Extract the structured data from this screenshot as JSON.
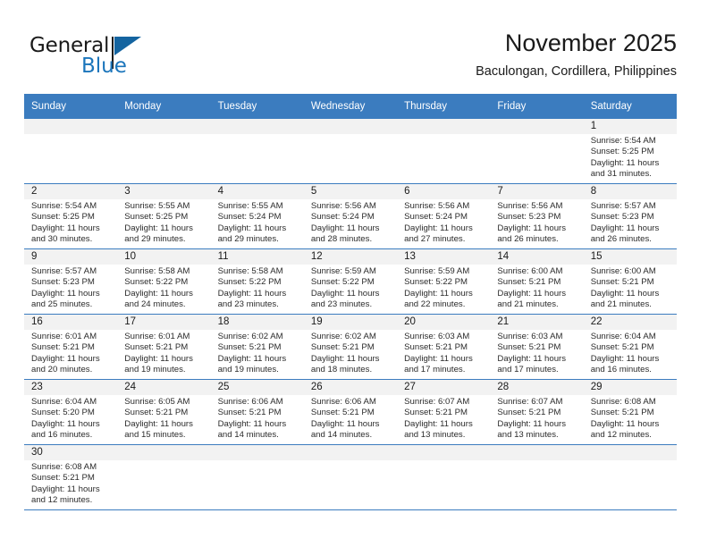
{
  "brand": {
    "word1": "General",
    "word2": "Blue",
    "flag_icon": "blue-triangle-flag-icon",
    "accent_color": "#1b75bb"
  },
  "header": {
    "title": "November 2025",
    "subtitle": "Baculongan, Cordillera, Philippines"
  },
  "theme": {
    "header_row_bg": "#3b7cbf",
    "daynum_band_bg": "#f2f2f2",
    "grid_line": "#3b7cbf"
  },
  "weekdays": [
    "Sunday",
    "Monday",
    "Tuesday",
    "Wednesday",
    "Thursday",
    "Friday",
    "Saturday"
  ],
  "weeks": [
    [
      {
        "day": "",
        "blank": true
      },
      {
        "day": "",
        "blank": true
      },
      {
        "day": "",
        "blank": true
      },
      {
        "day": "",
        "blank": true
      },
      {
        "day": "",
        "blank": true
      },
      {
        "day": "",
        "blank": true
      },
      {
        "day": "1",
        "sunrise": "Sunrise: 5:54 AM",
        "sunset": "Sunset: 5:25 PM",
        "daylight1": "Daylight: 11 hours",
        "daylight2": "and 31 minutes."
      }
    ],
    [
      {
        "day": "2",
        "sunrise": "Sunrise: 5:54 AM",
        "sunset": "Sunset: 5:25 PM",
        "daylight1": "Daylight: 11 hours",
        "daylight2": "and 30 minutes."
      },
      {
        "day": "3",
        "sunrise": "Sunrise: 5:55 AM",
        "sunset": "Sunset: 5:25 PM",
        "daylight1": "Daylight: 11 hours",
        "daylight2": "and 29 minutes."
      },
      {
        "day": "4",
        "sunrise": "Sunrise: 5:55 AM",
        "sunset": "Sunset: 5:24 PM",
        "daylight1": "Daylight: 11 hours",
        "daylight2": "and 29 minutes."
      },
      {
        "day": "5",
        "sunrise": "Sunrise: 5:56 AM",
        "sunset": "Sunset: 5:24 PM",
        "daylight1": "Daylight: 11 hours",
        "daylight2": "and 28 minutes."
      },
      {
        "day": "6",
        "sunrise": "Sunrise: 5:56 AM",
        "sunset": "Sunset: 5:24 PM",
        "daylight1": "Daylight: 11 hours",
        "daylight2": "and 27 minutes."
      },
      {
        "day": "7",
        "sunrise": "Sunrise: 5:56 AM",
        "sunset": "Sunset: 5:23 PM",
        "daylight1": "Daylight: 11 hours",
        "daylight2": "and 26 minutes."
      },
      {
        "day": "8",
        "sunrise": "Sunrise: 5:57 AM",
        "sunset": "Sunset: 5:23 PM",
        "daylight1": "Daylight: 11 hours",
        "daylight2": "and 26 minutes."
      }
    ],
    [
      {
        "day": "9",
        "sunrise": "Sunrise: 5:57 AM",
        "sunset": "Sunset: 5:23 PM",
        "daylight1": "Daylight: 11 hours",
        "daylight2": "and 25 minutes."
      },
      {
        "day": "10",
        "sunrise": "Sunrise: 5:58 AM",
        "sunset": "Sunset: 5:22 PM",
        "daylight1": "Daylight: 11 hours",
        "daylight2": "and 24 minutes."
      },
      {
        "day": "11",
        "sunrise": "Sunrise: 5:58 AM",
        "sunset": "Sunset: 5:22 PM",
        "daylight1": "Daylight: 11 hours",
        "daylight2": "and 23 minutes."
      },
      {
        "day": "12",
        "sunrise": "Sunrise: 5:59 AM",
        "sunset": "Sunset: 5:22 PM",
        "daylight1": "Daylight: 11 hours",
        "daylight2": "and 23 minutes."
      },
      {
        "day": "13",
        "sunrise": "Sunrise: 5:59 AM",
        "sunset": "Sunset: 5:22 PM",
        "daylight1": "Daylight: 11 hours",
        "daylight2": "and 22 minutes."
      },
      {
        "day": "14",
        "sunrise": "Sunrise: 6:00 AM",
        "sunset": "Sunset: 5:21 PM",
        "daylight1": "Daylight: 11 hours",
        "daylight2": "and 21 minutes."
      },
      {
        "day": "15",
        "sunrise": "Sunrise: 6:00 AM",
        "sunset": "Sunset: 5:21 PM",
        "daylight1": "Daylight: 11 hours",
        "daylight2": "and 21 minutes."
      }
    ],
    [
      {
        "day": "16",
        "sunrise": "Sunrise: 6:01 AM",
        "sunset": "Sunset: 5:21 PM",
        "daylight1": "Daylight: 11 hours",
        "daylight2": "and 20 minutes."
      },
      {
        "day": "17",
        "sunrise": "Sunrise: 6:01 AM",
        "sunset": "Sunset: 5:21 PM",
        "daylight1": "Daylight: 11 hours",
        "daylight2": "and 19 minutes."
      },
      {
        "day": "18",
        "sunrise": "Sunrise: 6:02 AM",
        "sunset": "Sunset: 5:21 PM",
        "daylight1": "Daylight: 11 hours",
        "daylight2": "and 19 minutes."
      },
      {
        "day": "19",
        "sunrise": "Sunrise: 6:02 AM",
        "sunset": "Sunset: 5:21 PM",
        "daylight1": "Daylight: 11 hours",
        "daylight2": "and 18 minutes."
      },
      {
        "day": "20",
        "sunrise": "Sunrise: 6:03 AM",
        "sunset": "Sunset: 5:21 PM",
        "daylight1": "Daylight: 11 hours",
        "daylight2": "and 17 minutes."
      },
      {
        "day": "21",
        "sunrise": "Sunrise: 6:03 AM",
        "sunset": "Sunset: 5:21 PM",
        "daylight1": "Daylight: 11 hours",
        "daylight2": "and 17 minutes."
      },
      {
        "day": "22",
        "sunrise": "Sunrise: 6:04 AM",
        "sunset": "Sunset: 5:21 PM",
        "daylight1": "Daylight: 11 hours",
        "daylight2": "and 16 minutes."
      }
    ],
    [
      {
        "day": "23",
        "sunrise": "Sunrise: 6:04 AM",
        "sunset": "Sunset: 5:20 PM",
        "daylight1": "Daylight: 11 hours",
        "daylight2": "and 16 minutes."
      },
      {
        "day": "24",
        "sunrise": "Sunrise: 6:05 AM",
        "sunset": "Sunset: 5:21 PM",
        "daylight1": "Daylight: 11 hours",
        "daylight2": "and 15 minutes."
      },
      {
        "day": "25",
        "sunrise": "Sunrise: 6:06 AM",
        "sunset": "Sunset: 5:21 PM",
        "daylight1": "Daylight: 11 hours",
        "daylight2": "and 14 minutes."
      },
      {
        "day": "26",
        "sunrise": "Sunrise: 6:06 AM",
        "sunset": "Sunset: 5:21 PM",
        "daylight1": "Daylight: 11 hours",
        "daylight2": "and 14 minutes."
      },
      {
        "day": "27",
        "sunrise": "Sunrise: 6:07 AM",
        "sunset": "Sunset: 5:21 PM",
        "daylight1": "Daylight: 11 hours",
        "daylight2": "and 13 minutes."
      },
      {
        "day": "28",
        "sunrise": "Sunrise: 6:07 AM",
        "sunset": "Sunset: 5:21 PM",
        "daylight1": "Daylight: 11 hours",
        "daylight2": "and 13 minutes."
      },
      {
        "day": "29",
        "sunrise": "Sunrise: 6:08 AM",
        "sunset": "Sunset: 5:21 PM",
        "daylight1": "Daylight: 11 hours",
        "daylight2": "and 12 minutes."
      }
    ],
    [
      {
        "day": "30",
        "sunrise": "Sunrise: 6:08 AM",
        "sunset": "Sunset: 5:21 PM",
        "daylight1": "Daylight: 11 hours",
        "daylight2": "and 12 minutes."
      },
      {
        "day": "",
        "blank": true
      },
      {
        "day": "",
        "blank": true
      },
      {
        "day": "",
        "blank": true
      },
      {
        "day": "",
        "blank": true
      },
      {
        "day": "",
        "blank": true
      },
      {
        "day": "",
        "blank": true
      }
    ]
  ]
}
